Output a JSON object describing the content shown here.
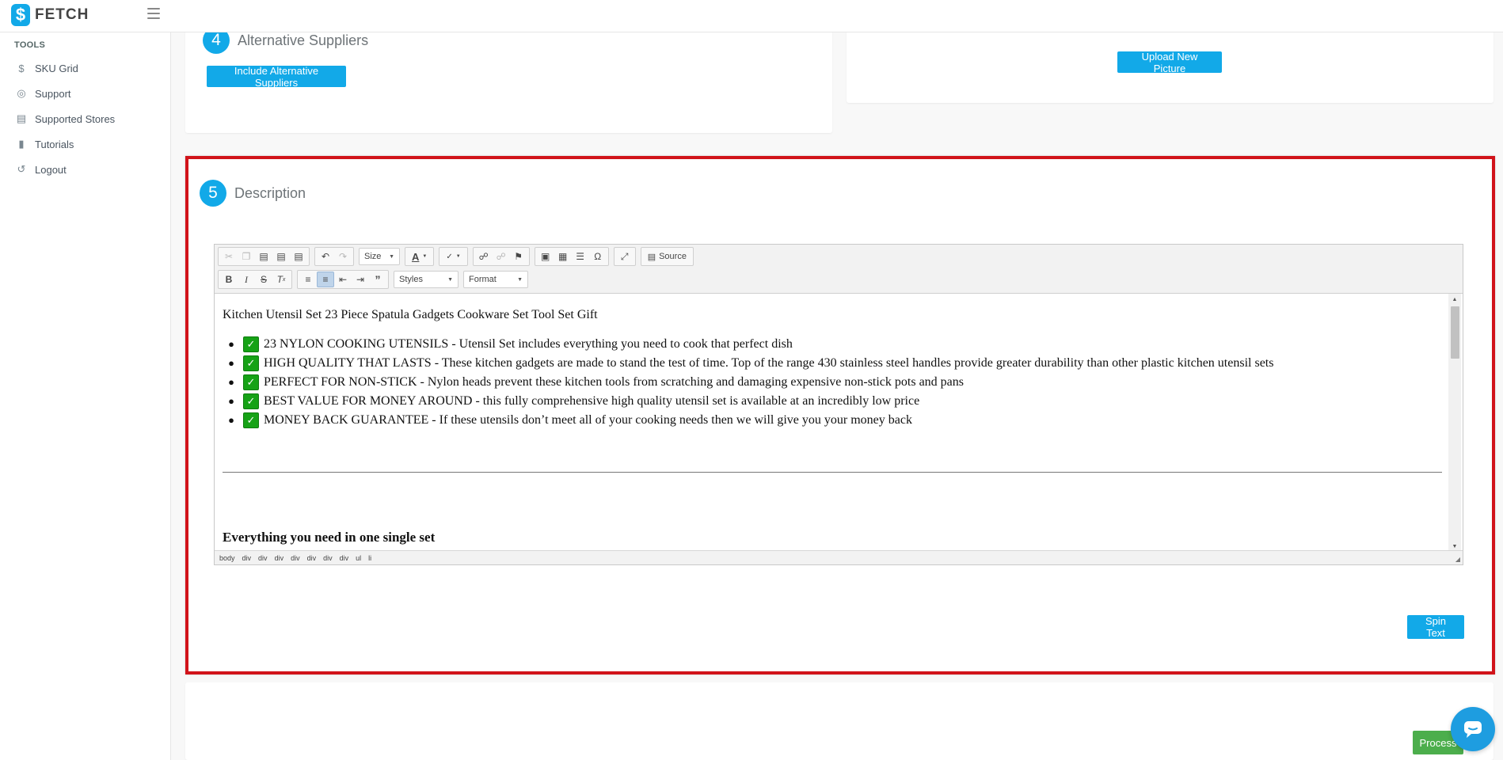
{
  "app": {
    "logo_text": "FETCH",
    "logo_glyph": "$"
  },
  "sidebar": {
    "heading": "TOOLS",
    "items": [
      {
        "label": "SKU Grid",
        "icon": "dollar-circle-icon"
      },
      {
        "label": "Support",
        "icon": "lifebuoy-icon"
      },
      {
        "label": "Supported Stores",
        "icon": "store-icon"
      },
      {
        "label": "Tutorials",
        "icon": "library-icon"
      },
      {
        "label": "Logout",
        "icon": "logout-icon"
      }
    ]
  },
  "step4": {
    "number": "4",
    "title": "Alternative Suppliers",
    "button": "Include Alternative Suppliers"
  },
  "picture": {
    "button": "Upload New Picture"
  },
  "step5": {
    "number": "5",
    "title": "Description",
    "editor": {
      "toolbar": {
        "size_label": "Size",
        "styles_label": "Styles",
        "format_label": "Format",
        "source_label": "Source"
      },
      "content": {
        "title_line": "Kitchen Utensil Set 23 Piece Spatula Gadgets Cookware Set Tool Set Gift",
        "bullets": [
          "23 NYLON COOKING UTENSILS - Utensil Set includes everything you need to cook that perfect dish",
          "HIGH QUALITY THAT LASTS - These kitchen gadgets are made to stand the test of time. Top of the range 430 stainless steel handles provide greater durability than other plastic kitchen utensil sets",
          "PERFECT FOR NON-STICK - Nylon heads prevent these kitchen tools from scratching and damaging expensive non-stick pots and pans",
          "BEST VALUE FOR MONEY AROUND - this fully comprehensive high quality utensil set is available at an incredibly low price",
          "MONEY BACK GUARANTEE - If these utensils don’t meet all of your cooking needs then we will give you your money back"
        ],
        "bold_heading": "Everything you need in one single set"
      },
      "path": [
        "body",
        "div",
        "div",
        "div",
        "div",
        "div",
        "div",
        "div",
        "ul",
        "li"
      ]
    },
    "spin_button": "Spin Text"
  },
  "process_button": "Process",
  "colors": {
    "accent": "#12a9e8",
    "highlight": "#d1131a",
    "success": "#4cae4c",
    "check": "#16a216"
  }
}
